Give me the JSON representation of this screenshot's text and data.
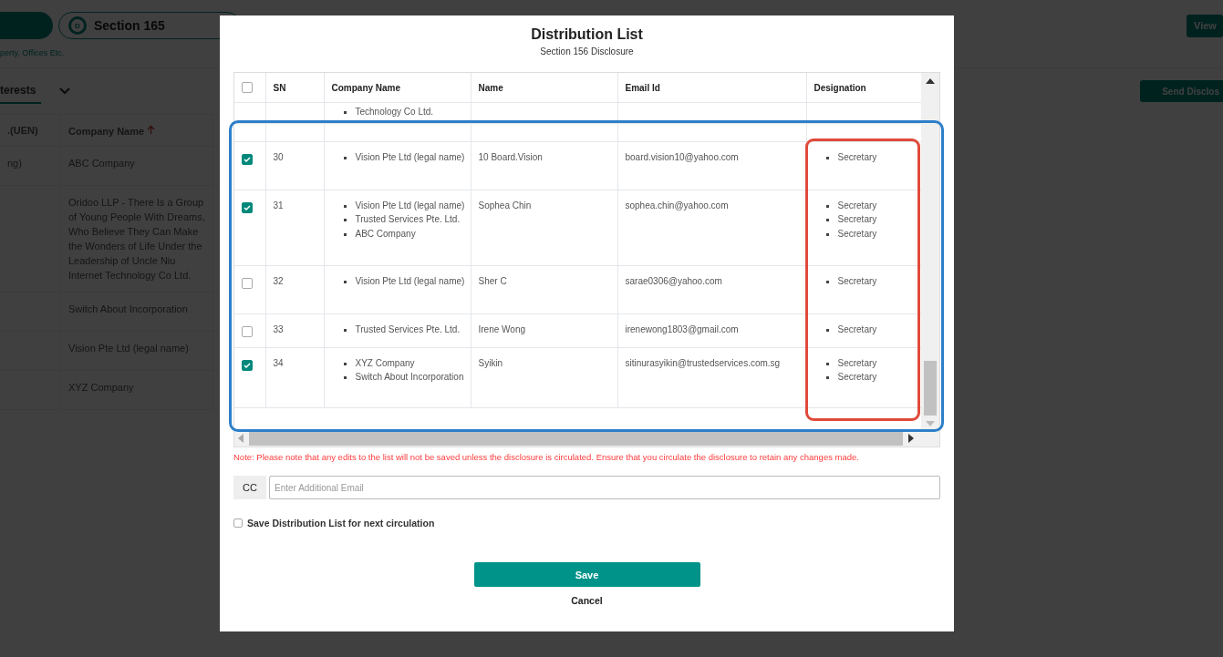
{
  "background": {
    "section_pill": {
      "icon_letter": "D",
      "label": "Section 165"
    },
    "subtitle": "perty, Offices Etc.",
    "tab": {
      "label": "terests"
    },
    "view_button": "View",
    "send_button": "Send Disclos",
    "table": {
      "columns": [
        ".(UEN)",
        "Company Name"
      ],
      "rows": [
        {
          "cells": [
            "ng)",
            "ABC Company"
          ]
        },
        {
          "cells": [
            "",
            "Oridoo LLP - There Is a Group of Young People With Dreams, Who Believe They Can Make the Wonders of Life Under the Leadership of Uncle Niu Internet Technology Co Ltd."
          ]
        },
        {
          "cells": [
            "",
            "Switch About Incorporation"
          ]
        },
        {
          "cells": [
            "",
            "Vision Pte Ltd (legal name)"
          ]
        },
        {
          "cells": [
            "",
            "XYZ Company"
          ]
        }
      ]
    }
  },
  "dialog": {
    "title": "Distribution List",
    "subtitle": "Section 156 Disclosure",
    "table": {
      "header_checked": false,
      "columns": [
        "SN",
        "Company Name",
        "Name",
        "Email Id",
        "Designation"
      ],
      "partial_row": {
        "companies": [
          "Technology Co Ltd."
        ]
      },
      "rows": [
        {
          "checked": true,
          "sn": "30",
          "companies": [
            "Vision Pte Ltd (legal name)"
          ],
          "name": "10 Board.Vision",
          "email": "board.vision10@yahoo.com",
          "designations": [
            "Secretary"
          ]
        },
        {
          "checked": true,
          "sn": "31",
          "companies": [
            "Vision Pte Ltd (legal name)",
            "Trusted Services Pte. Ltd.",
            "ABC Company"
          ],
          "name": "Sophea Chin",
          "email": "sophea.chin@yahoo.com",
          "designations": [
            "Secretary",
            "Secretary",
            "Secretary"
          ]
        },
        {
          "checked": false,
          "sn": "32",
          "companies": [
            "Vision Pte Ltd (legal name)"
          ],
          "name": "Sher C",
          "email": "sarae0306@yahoo.com",
          "designations": [
            "Secretary"
          ]
        },
        {
          "checked": false,
          "sn": "33",
          "companies": [
            "Trusted Services Pte. Ltd."
          ],
          "name": "Irene Wong",
          "email": "irenewong1803@gmail.com",
          "designations": [
            "Secretary"
          ]
        },
        {
          "checked": true,
          "sn": "34",
          "companies": [
            "XYZ Company",
            "Switch About Incorporation"
          ],
          "name": "Syikin",
          "email": "sitinurasyikin@trustedservices.com.sg",
          "designations": [
            "Secretary",
            "Secretary"
          ]
        }
      ]
    },
    "note": "Note: Please note that any edits to the list will not be saved unless the disclosure is circulated. Ensure that you circulate the disclosure to retain any changes made.",
    "cc": {
      "label": "CC",
      "placeholder": "Enter Additional Email"
    },
    "save_list": {
      "label": "Save Distribution List for next circulation",
      "checked": false
    },
    "save_button": "Save",
    "cancel_button": "Cancel"
  }
}
